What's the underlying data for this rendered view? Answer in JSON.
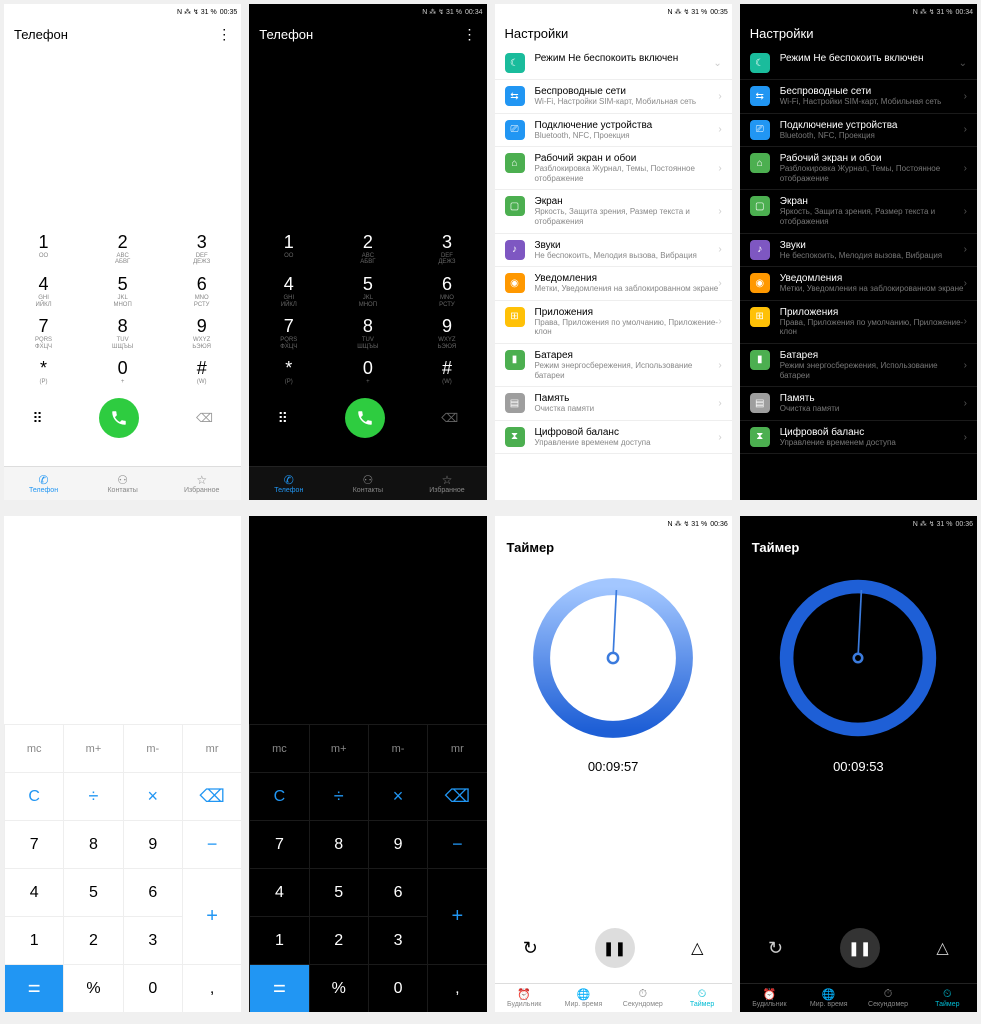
{
  "status": {
    "icons": "N ⁂ ↯ 31 %",
    "time1": "00:35",
    "time2": "00:34",
    "time3": "00:35",
    "time4": "00:34",
    "time5": "00:36",
    "time6": "00:36"
  },
  "phone_app": {
    "title": "Телефон",
    "keys": [
      {
        "n": "1",
        "s": "OO"
      },
      {
        "n": "2",
        "s": "ABC\nАБВГ"
      },
      {
        "n": "3",
        "s": "DEF\nДЕЖЗ"
      },
      {
        "n": "4",
        "s": "GHI\nИЙКЛ"
      },
      {
        "n": "5",
        "s": "JKL\nМНОП"
      },
      {
        "n": "6",
        "s": "MNO\nРСТУ"
      },
      {
        "n": "7",
        "s": "PQRS\nФХЦЧ"
      },
      {
        "n": "8",
        "s": "TUV\nШЩЪЫ"
      },
      {
        "n": "9",
        "s": "WXYZ\nЬЭЮЯ"
      },
      {
        "n": "*",
        "s": "(P)"
      },
      {
        "n": "0",
        "s": "+"
      },
      {
        "n": "#",
        "s": "(W)"
      }
    ],
    "tabs": [
      {
        "label": "Телефон",
        "active": true
      },
      {
        "label": "Контакты",
        "active": false
      },
      {
        "label": "Избранное",
        "active": false
      }
    ]
  },
  "settings": {
    "title": "Настройки",
    "dnd": "Режим Не беспокоить включен",
    "items": [
      {
        "color": "#2196f3",
        "ico": "⇆",
        "title": "Беспроводные сети",
        "sub": "Wi-Fi, Настройки SIM-карт, Мобильная сеть"
      },
      {
        "color": "#2196f3",
        "ico": "⎚",
        "title": "Подключение устройства",
        "sub": "Bluetooth, NFC, Проекция"
      },
      {
        "color": "#4caf50",
        "ico": "⌂",
        "title": "Рабочий экран и обои",
        "sub": "Разблокировка Журнал, Темы, Постоянное отображение"
      },
      {
        "color": "#4caf50",
        "ico": "▢",
        "title": "Экран",
        "sub": "Яркость, Защита зрения, Размер текста и отображения"
      },
      {
        "color": "#7e57c2",
        "ico": "♪",
        "title": "Звуки",
        "sub": "Не беспокоить, Мелодия вызова, Вибрация"
      },
      {
        "color": "#ff9800",
        "ico": "◉",
        "title": "Уведомления",
        "sub": "Метки, Уведомления на заблокированном экране"
      },
      {
        "color": "#ffc107",
        "ico": "⊞",
        "title": "Приложения",
        "sub": "Права, Приложения по умолчанию, Приложение-клон"
      },
      {
        "color": "#4caf50",
        "ico": "▮",
        "title": "Батарея",
        "sub": "Режим энергосбережения, Использование батареи"
      },
      {
        "color": "#9e9e9e",
        "ico": "▤",
        "title": "Память",
        "sub": "Очистка памяти"
      },
      {
        "color": "#4caf50",
        "ico": "⧗",
        "title": "Цифровой баланс",
        "sub": "Управление временем доступа"
      }
    ]
  },
  "calc": {
    "mem": [
      "mc",
      "m+",
      "m-",
      "mr"
    ],
    "r1": [
      "C",
      "÷",
      "×"
    ],
    "backspace": "⌫",
    "r2": [
      "7",
      "8",
      "9",
      "−"
    ],
    "r3": [
      "4",
      "5",
      "6"
    ],
    "plus": "+",
    "r4": [
      "1",
      "2",
      "3"
    ],
    "eq": "=",
    "r5": [
      "%",
      "0",
      ","
    ]
  },
  "timer": {
    "title": "Таймер",
    "time_light": "00:09:57",
    "time_dark": "00:09:53",
    "reset": "↻",
    "pause": "❚❚",
    "bell": "♢",
    "tabs": [
      {
        "label": "Будильник"
      },
      {
        "label": "Мир. время"
      },
      {
        "label": "Секундомер"
      },
      {
        "label": "Таймер",
        "active": true
      }
    ]
  }
}
